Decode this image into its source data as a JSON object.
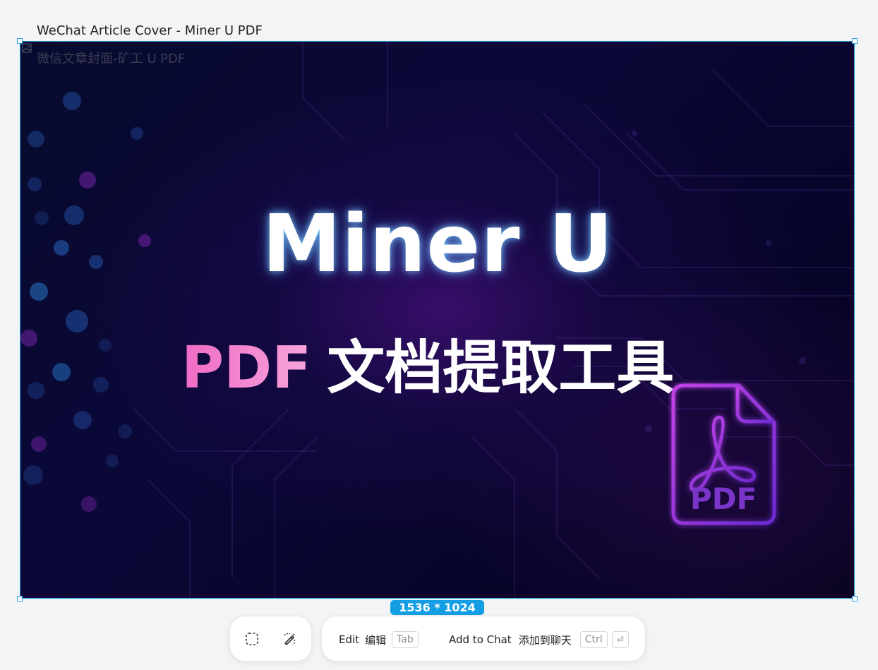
{
  "canvas": {
    "title": "WeChat Article Cover - Miner U PDF",
    "subtitle": "微信文章封面-矿工 U PDF",
    "size_label": "1536 * 1024"
  },
  "artwork": {
    "headline": "Miner U",
    "subline_accent": "PDF",
    "subline_text": "文档提取工具",
    "icon_label": "PDF"
  },
  "toolbar": {
    "select_tool_icon": "dashed-select-icon",
    "edit_tool_icon": "magic-pen-icon",
    "edit_label": "Edit",
    "edit_label_cn": "编辑",
    "edit_shortcut": "Tab",
    "chat_label": "Add to Chat",
    "chat_label_cn": "添加到聊天",
    "chat_shortcut": "Ctrl",
    "chat_shortcut_key": "⏎"
  },
  "colors": {
    "selection": "#29a3e6",
    "badge": "#139ee4",
    "accent_pink": "#ee78c8",
    "icon_purple": "#b44be0"
  }
}
